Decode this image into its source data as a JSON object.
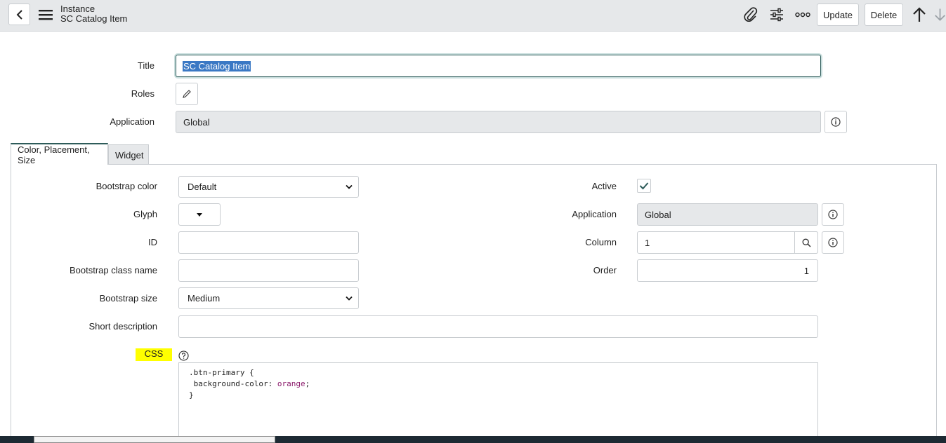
{
  "header": {
    "line1": "Instance",
    "line2": "SC Catalog Item",
    "update_label": "Update",
    "delete_label": "Delete"
  },
  "form": {
    "title_label": "Title",
    "title_value": "SC Catalog Item",
    "roles_label": "Roles",
    "application_label": "Application",
    "application_value": "Global"
  },
  "tabs": [
    {
      "label": "Color, Placement, Size",
      "active": true
    },
    {
      "label": "Widget",
      "active": false
    }
  ],
  "left": {
    "bootstrap_color_label": "Bootstrap color",
    "bootstrap_color_value": "Default",
    "glyph_label": "Glyph",
    "id_label": "ID",
    "id_value": "",
    "bootstrap_class_label": "Bootstrap class name",
    "bootstrap_class_value": "",
    "bootstrap_size_label": "Bootstrap size",
    "bootstrap_size_value": "Medium",
    "short_desc_label": "Short description",
    "short_desc_value": "",
    "css_label": "CSS",
    "css_code_line1": ".btn-primary {",
    "css_code_line2a": " background-color: ",
    "css_code_line2b": "orange",
    "css_code_line2c": ";",
    "css_code_line3": "}"
  },
  "right": {
    "active_label": "Active",
    "active_checked": true,
    "application_label": "Application",
    "application_value": "Global",
    "column_label": "Column",
    "column_value": "1",
    "order_label": "Order",
    "order_value": "1"
  },
  "colors": {
    "highlight": "#ffff00",
    "selection": "#3a78c4",
    "active_tab_border": "#2e5c5a",
    "code_keyword": "#8b1a6b"
  }
}
